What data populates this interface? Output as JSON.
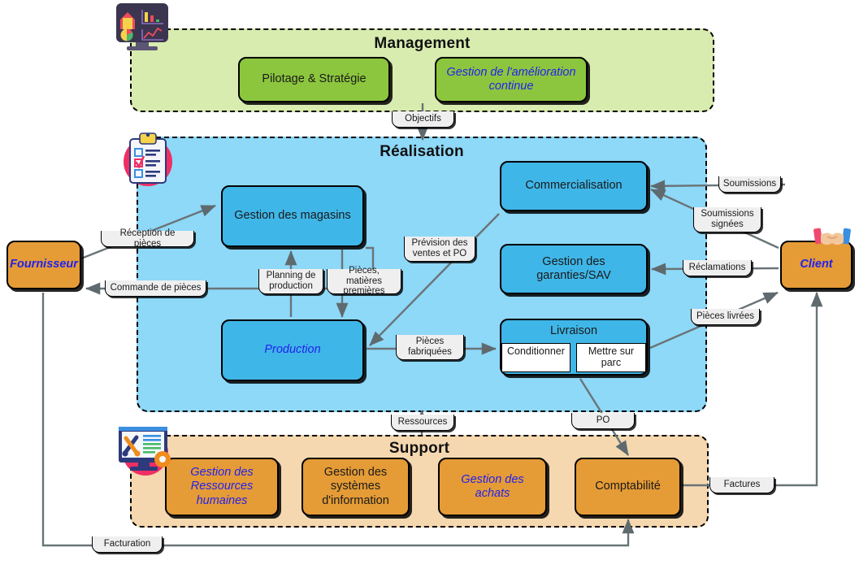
{
  "lanes": {
    "management": {
      "title": "Management"
    },
    "realisation": {
      "title": "Réalisation"
    },
    "support": {
      "title": "Support"
    }
  },
  "processes": {
    "pilotage": "Pilotage & Stratégie",
    "amelioration": "Gestion de l'amélioration continue",
    "magasins": "Gestion des magasins",
    "production": "Production",
    "commercialisation": "Commercialisation",
    "garanties": "Gestion des garanties/SAV",
    "livraison": {
      "title": "Livraison",
      "sub1": "Conditionner",
      "sub2": "Mettre sur parc"
    },
    "grh": "Gestion des Ressources humaines",
    "gsi": "Gestion des systèmes d'information",
    "achats": "Gestion des achats",
    "comptabilite": "Comptabilité"
  },
  "actors": {
    "fournisseur": "Fournisseur",
    "client": "Client"
  },
  "flows": {
    "objectifs": "Objectifs",
    "reception_pieces": "Réception de pièces",
    "commande_pieces": "Commande de pièces",
    "planning_production": "Planning de production",
    "pieces_matieres": "Pièces, matières premières",
    "prevision_ventes": "Prévision des ventes et PO",
    "pieces_fabriquees": "Pièces fabriquées",
    "soumissions": "Soumissions",
    "soumissions_signees": "Soumissions signées",
    "reclamations": "Réclamations",
    "pieces_livrees": "Pièces livrées",
    "ressources": "Ressources",
    "po": "PO",
    "factures": "Factures",
    "facturation": "Facturation"
  },
  "icons": {
    "management": "monitor-dashboard-icon",
    "realisation": "clipboard-checklist-icon",
    "support": "monitor-tools-icon",
    "client": "handshake-icon"
  },
  "colors": {
    "management_lane": "#d9ecb0",
    "management_box": "#8cc63e",
    "realisation_lane": "#8ed8f8",
    "realisation_box": "#3fb6e8",
    "support_lane": "#f5d8b0",
    "support_box": "#e59b36",
    "actor_box": "#e59b36",
    "tag_bg": "#efefef",
    "connector": "#666666",
    "emphasis_text": "#2222ee"
  }
}
